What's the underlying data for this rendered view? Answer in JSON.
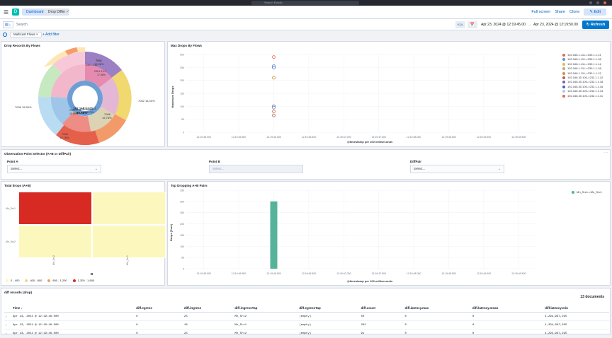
{
  "topbar": {
    "search_placeholder": "Search Elastic"
  },
  "nav": {
    "breadcrumbs": [
      "Dashboard",
      "Drop Differ"
    ],
    "links": {
      "fullscreen": "Full screen",
      "share": "Share",
      "clone": "Clone",
      "edit": "Edit"
    }
  },
  "query": {
    "placeholder": "Search",
    "language": "KQL",
    "date_start": "Apr 23, 2024 @ 12:19:45.00",
    "date_end": "Apr 23, 2024 @ 12:19:50.00",
    "refresh_label": "Refresh"
  },
  "filters": {
    "pill": "Multicast Flows",
    "add_label": "+ Add filter"
  },
  "drop_records": {
    "title": "Drop Records By Flows",
    "labels": {
      "inner": "192.168.1.111",
      "inner_pct": "80.68%",
      "t001": "7001",
      "t001_pct": "17.38%",
      "t002": "7002",
      "t002_pct": "18.40%",
      "t006": "7006",
      "t006_pct": "15.78%",
      "t008": "7008",
      "t008_pct": "15.59%",
      "t004": "7004",
      "t004_pct": "15.78%",
      "r230a": "230.1.1.11",
      "r230a_pct": "17.38%",
      "r230b": "230.1.1.18",
      "r230b_pct": "16.78%",
      "r230c": "230.1.1.14",
      "r230c_pct": "15.59%",
      "r230d": "230.1.1.12"
    }
  },
  "max_drops": {
    "title": "Max Drops By Flows",
    "ylabel": "Maximum Drops",
    "xlabel": "@timestamp per 100 milliseconds",
    "yticks": [
      "300",
      "250",
      "200",
      "150",
      "100",
      "50",
      "0"
    ],
    "xticks": [
      "12:19:45.000",
      "12:19:45.500",
      "12:19:46.000",
      "12:19:46.500",
      "12:19:47.000",
      "12:19:47.500",
      "12:19:48.000",
      "12:19:48.500",
      "12:19:49.000",
      "12:19:49.500"
    ],
    "legend": [
      {
        "name": "192.168.1.111->230.1.1.11",
        "color": "#e7664c"
      },
      {
        "name": "192.168.1.111->230.1.1.16",
        "color": "#6092c0"
      },
      {
        "name": "192.168.1.111->230.1.1.14",
        "color": "#d6bf57"
      },
      {
        "name": "192.168.1.111->230.1.1.18",
        "color": "#b9a888"
      },
      {
        "name": "192.168.1.111->230.1.1.12",
        "color": "#da8b45"
      },
      {
        "name": "192.168.30.100->232.1.1.12",
        "color": "#aa6556"
      },
      {
        "name": "192.168.30.100->232.1.1.18",
        "color": "#7b5ea7"
      },
      {
        "name": "192.168.30.100->232.1.1.16",
        "color": "#4b5fc9"
      },
      {
        "name": "192.168.30.100->232.1.1.14",
        "color": "#b0c9e0"
      },
      {
        "name": "192.168.30.100->232.1.1.11",
        "color": "#e7664c"
      }
    ]
  },
  "chart_data": [
    {
      "type": "scatter",
      "title": "Max Drops By Flows",
      "ylabel": "Maximum Drops",
      "xlabel": "@timestamp per 100 milliseconds",
      "ylim": [
        0,
        300
      ],
      "points": [
        {
          "x": "12:19:46.000",
          "y": 290,
          "color": "#e7664c"
        },
        {
          "x": "12:19:46.000",
          "y": 255,
          "color": "#6092c0"
        },
        {
          "x": "12:19:46.000",
          "y": 250,
          "color": "#4b5fc9"
        },
        {
          "x": "12:19:46.000",
          "y": 210,
          "color": "#da8b45"
        },
        {
          "x": "12:19:46.000",
          "y": 100,
          "color": "#7b5ea7"
        },
        {
          "x": "12:19:46.000",
          "y": 95,
          "color": "#6092c0"
        },
        {
          "x": "12:19:46.000",
          "y": 80,
          "color": "#e7664c"
        },
        {
          "x": "12:19:46.000",
          "y": 65,
          "color": "#aa6556"
        }
      ]
    },
    {
      "type": "heatmap",
      "title": "Total drops (A+B)",
      "x": [
        "Mn_Src2",
        "Mn_Src1"
      ],
      "y": [
        "Mn_Src1",
        "Mn_Src2"
      ],
      "values": [
        [
          1500,
          300
        ],
        [
          300,
          300
        ]
      ],
      "color_bins": [
        "0 - 400",
        "400 - 800",
        "800 - 1,200",
        "1,200 - 1,600"
      ]
    },
    {
      "type": "bar",
      "title": "Top Dropping A+B Pairs",
      "ylabel": "Drops (Sum)",
      "xlabel": "@timestamp per 100 milliseconds",
      "ylim": [
        0,
        350
      ],
      "series": [
        {
          "name": "Mn_Src1->Mn_Src1",
          "x": "12:19:46.000",
          "value": 300
        }
      ]
    }
  ],
  "heat": {
    "title": "Total drops (A+B)",
    "rows": [
      "Mn_Src1",
      "Mn_Src2"
    ],
    "cols": [
      "Mn_Src2",
      "Mn_Src1"
    ],
    "xfield": "B",
    "legend": [
      {
        "label": "0 - 400",
        "color": "#fcf7bc"
      },
      {
        "label": "400 - 800",
        "color": "#f5d283"
      },
      {
        "label": "800 - 1,200",
        "color": "#eda05a"
      },
      {
        "label": "1,200 - 1,600",
        "color": "#d62a23"
      }
    ]
  },
  "top_pairs": {
    "title": "Top Dropping A+B Pairs",
    "ylabel": "Drops (Sum)",
    "xlabel": "@timestamp per 100 milliseconds",
    "yticks": [
      "350",
      "300",
      "250",
      "200",
      "150",
      "100",
      "50",
      "0"
    ],
    "legend_item": "Mn_Src1->Mn_Src1"
  },
  "observation": {
    "title": "Observation Point Selector (A+B or DiffPair)",
    "point_a_label": "Point A",
    "point_a_value": "Select...",
    "point_b_label": "Point B",
    "point_b_value": "Select...",
    "diffpair_label": "DiffPair",
    "diffpair_value": "Select..."
  },
  "diff_records": {
    "title": "diff records (drop)",
    "count": "13 documents",
    "columns": [
      "Time",
      "diff.egress",
      "diff.ingress",
      "diff.ingressTap",
      "diff.egressTap",
      "diff.count",
      "diff.latency.max",
      "diff.latency.mean",
      "diff.latency.min"
    ],
    "rows": [
      [
        "Apr 23, 2024 @ 12:19:46.000",
        "0",
        "23",
        "Mn_Src2",
        "(empty)",
        "50",
        "0",
        "0",
        "4,294,967,295"
      ],
      [
        "Apr 23, 2024 @ 12:19:46.000",
        "0",
        "16",
        "Mn_Src1",
        "(empty)",
        "202",
        "0",
        "0",
        "4,294,967,295"
      ],
      [
        "Apr 23, 2024 @ 12:19:46.000",
        "0",
        "23",
        "Mn_Src2",
        "(empty)",
        "91",
        "0",
        "0",
        "4,294,967,295"
      ]
    ]
  }
}
